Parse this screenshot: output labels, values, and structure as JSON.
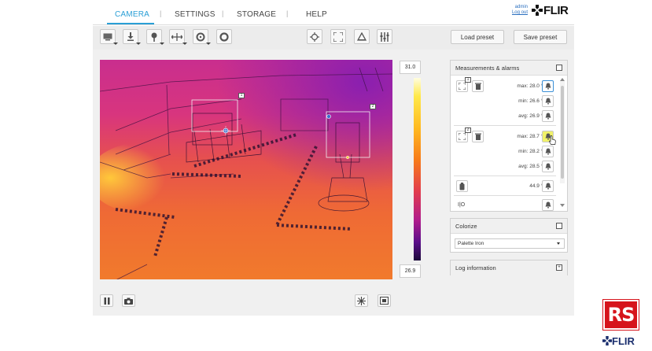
{
  "nav": {
    "tabs": [
      {
        "label": "CAMERA",
        "active": true
      },
      {
        "label": "SETTINGS",
        "active": false
      },
      {
        "label": "STORAGE",
        "active": false
      },
      {
        "label": "HELP",
        "active": false
      }
    ],
    "separator": "|",
    "user": "admin",
    "logout": "Log out",
    "brand": "FLIR"
  },
  "toolbar": {
    "icons": [
      "monitor-icon",
      "download-icon",
      "pin-icon",
      "line-tool-icon",
      "circle-tool-icon",
      "circle-outline-icon",
      "crosshair-icon",
      "fullscreen-icon",
      "triangle-icon",
      "bars-icon"
    ],
    "load_preset": "Load preset",
    "save_preset": "Save preset"
  },
  "image": {
    "roi1_label": "1",
    "roi2_label": "2"
  },
  "scale": {
    "max": "31.0",
    "min": "26.9"
  },
  "measurements": {
    "title": "Measurements & alarms",
    "box1": {
      "id": "1",
      "max": "max: 28.0 °C",
      "min": "min: 26.6 °C",
      "avg": "avg: 26.9 °C"
    },
    "box2": {
      "id": "2",
      "max": "max: 28.7 °C",
      "min": "min: 28.2 °C",
      "avg": "avg: 28.5 °C"
    },
    "spot_value": "44.9 °C",
    "io_label": "I|O",
    "io_value": "0"
  },
  "colorize": {
    "title": "Colorize",
    "palette": "Palette Iron"
  },
  "log": {
    "title": "Log information",
    "toggle": "+"
  },
  "brand_bottom": {
    "rs": "RS",
    "flir": "FLIR"
  },
  "colors": {
    "accent": "#2a9fd6",
    "alarm_active": "#f1f26a",
    "rs_red": "#d6141c"
  }
}
